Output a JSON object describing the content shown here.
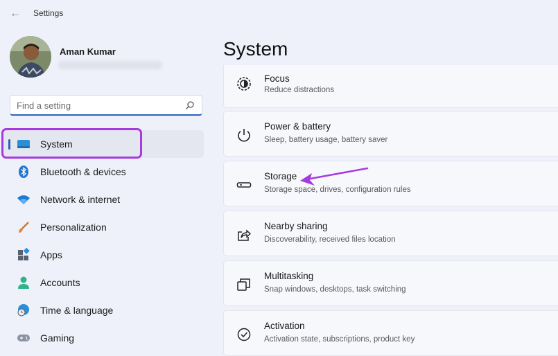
{
  "window": {
    "title": "Settings"
  },
  "user": {
    "name": "Aman Kumar"
  },
  "search": {
    "placeholder": "Find a setting"
  },
  "sidebar": {
    "items": [
      {
        "label": "System",
        "icon": "monitor-icon",
        "active": true
      },
      {
        "label": "Bluetooth & devices",
        "icon": "bluetooth-icon"
      },
      {
        "label": "Network & internet",
        "icon": "wifi-icon"
      },
      {
        "label": "Personalization",
        "icon": "brush-icon"
      },
      {
        "label": "Apps",
        "icon": "apps-icon"
      },
      {
        "label": "Accounts",
        "icon": "person-icon"
      },
      {
        "label": "Time & language",
        "icon": "globe-clock-icon"
      },
      {
        "label": "Gaming",
        "icon": "gamepad-icon"
      }
    ]
  },
  "main": {
    "title": "System",
    "cards": [
      {
        "title": "Focus",
        "subtitle": "Reduce distractions",
        "icon": "focus-icon"
      },
      {
        "title": "Power & battery",
        "subtitle": "Sleep, battery usage, battery saver",
        "icon": "power-icon"
      },
      {
        "title": "Storage",
        "subtitle": "Storage space, drives, configuration rules",
        "icon": "storage-icon"
      },
      {
        "title": "Nearby sharing",
        "subtitle": "Discoverability, received files location",
        "icon": "share-icon"
      },
      {
        "title": "Multitasking",
        "subtitle": "Snap windows, desktops, task switching",
        "icon": "multitasking-icon"
      },
      {
        "title": "Activation",
        "subtitle": "Activation state, subscriptions, product key",
        "icon": "check-circle-icon"
      }
    ]
  },
  "colors": {
    "accent": "#2a63b8",
    "highlight": "#a53ae0",
    "background": "#eef1f9"
  }
}
